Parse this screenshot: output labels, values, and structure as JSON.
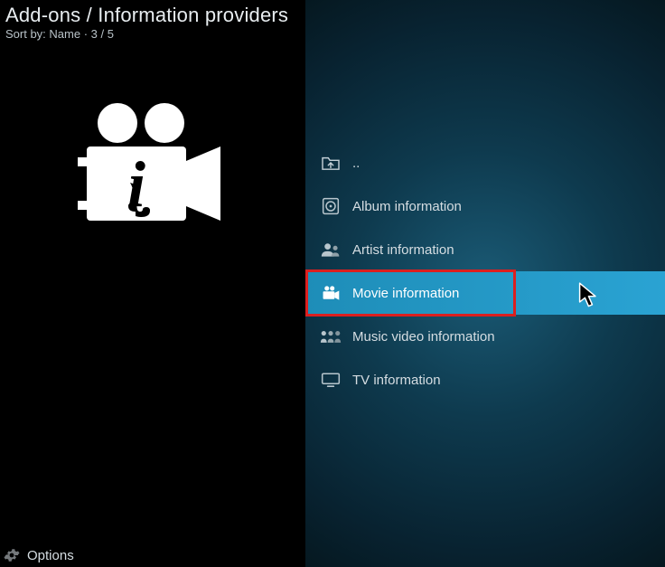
{
  "header": {
    "title": "Add-ons / Information providers",
    "sort_line": "Sort by: Name  ·  3 / 5"
  },
  "list": {
    "parent": "..",
    "items": [
      {
        "label": "Album information"
      },
      {
        "label": "Artist information"
      },
      {
        "label": "Movie information"
      },
      {
        "label": "Music video information"
      },
      {
        "label": "TV information"
      }
    ]
  },
  "footer": {
    "options": "Options"
  }
}
